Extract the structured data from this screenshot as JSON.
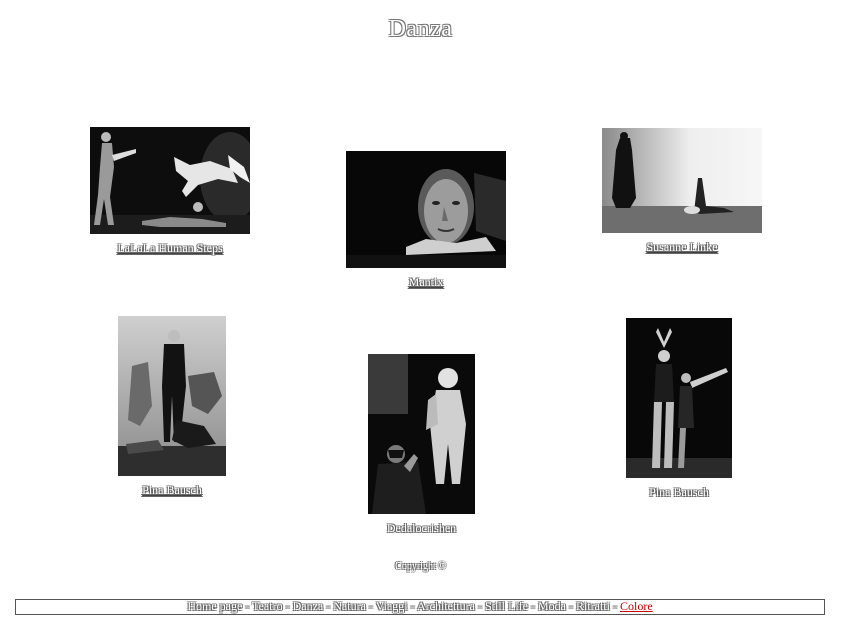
{
  "page_title": "Danza",
  "photos": [
    {
      "caption": "LaLaLa Human Steps",
      "linked": true
    },
    {
      "caption": "Mantix",
      "linked": true
    },
    {
      "caption": "Susanne Linke",
      "linked": true
    },
    {
      "caption": "Pina Bausch",
      "linked": true
    },
    {
      "caption": "Dedalocrishen",
      "linked": false
    },
    {
      "caption": "Pina Bausch",
      "linked": false
    }
  ],
  "copyright": "Copyright ©",
  "nav": {
    "items": [
      "Home page",
      "Teatro",
      "Danza",
      "Natura",
      "Viaggi",
      "Architettura",
      "Still Life",
      "Moda",
      "Ritratti",
      "Colore"
    ],
    "separator": "-",
    "current": "Colore"
  },
  "colors": {
    "background": "#ffffff",
    "active_link": "#cc0000"
  }
}
